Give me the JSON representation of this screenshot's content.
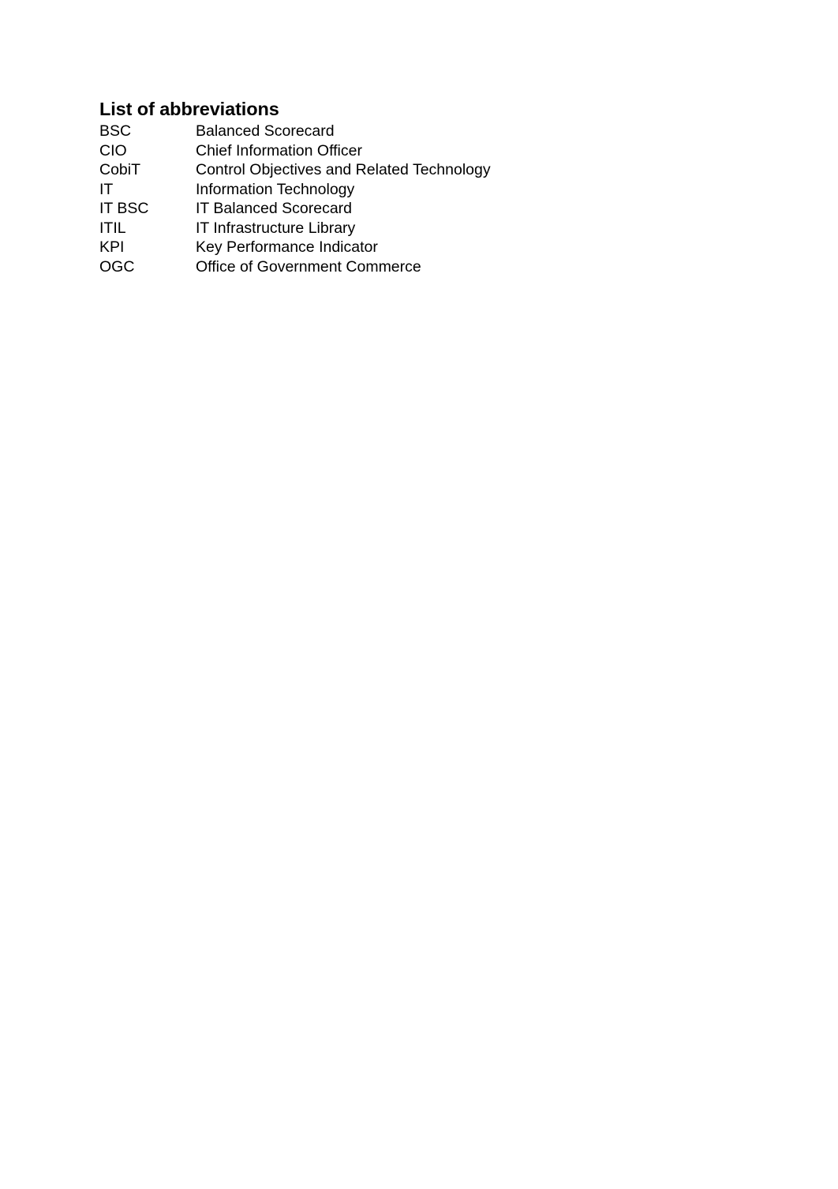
{
  "document": {
    "background_color": "#ffffff",
    "text_color": "#000000",
    "heading": "List of abbreviations",
    "abbreviations": [
      {
        "term": "BSC",
        "definition": "Balanced Scorecard"
      },
      {
        "term": "CIO",
        "definition": "Chief Information Officer"
      },
      {
        "term": "CobiT",
        "definition": "Control Objectives and Related Technology"
      },
      {
        "term": "IT",
        "definition": "Information Technology"
      },
      {
        "term": "IT BSC",
        "definition": "IT Balanced Scorecard"
      },
      {
        "term": "ITIL",
        "definition": "IT Infrastructure Library"
      },
      {
        "term": "KPI",
        "definition": "Key Performance Indicator"
      },
      {
        "term": "OGC",
        "definition": "Office of Government Commerce"
      }
    ]
  }
}
